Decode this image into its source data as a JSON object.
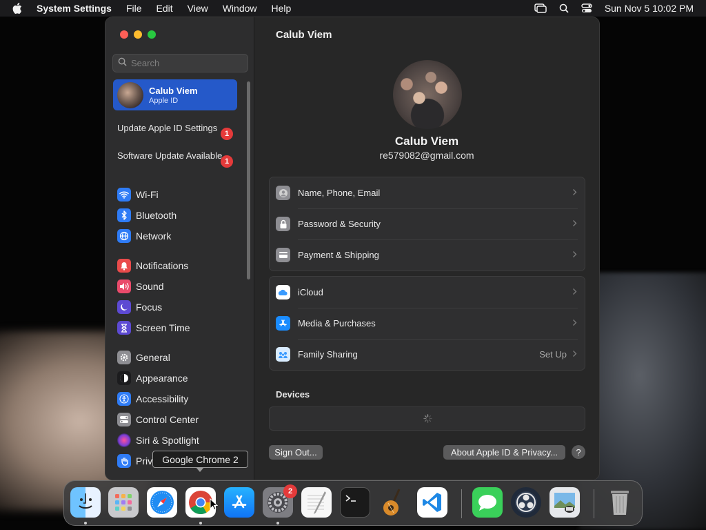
{
  "menubar": {
    "app_name": "System Settings",
    "items": [
      "File",
      "Edit",
      "View",
      "Window",
      "Help"
    ],
    "clock": "Sun Nov 5  10:02 PM"
  },
  "sidebar": {
    "search_placeholder": "Search",
    "account": {
      "name": "Calub Viem",
      "subtitle": "Apple ID"
    },
    "notices": [
      {
        "label": "Update Apple ID Settings",
        "badge": "1"
      },
      {
        "label": "Software Update Available",
        "badge": "1"
      }
    ],
    "items": [
      {
        "label": "Wi-Fi",
        "icon": "wifi-icon",
        "color": "#2f7cf6"
      },
      {
        "label": "Bluetooth",
        "icon": "bluetooth-icon",
        "color": "#2f7cf6"
      },
      {
        "label": "Network",
        "icon": "network-icon",
        "color": "#2f7cf6"
      },
      {
        "label": "Notifications",
        "icon": "bell-icon",
        "color": "#ea4b4b"
      },
      {
        "label": "Sound",
        "icon": "speaker-icon",
        "color": "#ea4b6b"
      },
      {
        "label": "Focus",
        "icon": "moon-icon",
        "color": "#5d4ad3"
      },
      {
        "label": "Screen Time",
        "icon": "hourglass-icon",
        "color": "#5d4ad3"
      },
      {
        "label": "General",
        "icon": "gear-icon",
        "color": "#8e8e93"
      },
      {
        "label": "Appearance",
        "icon": "appearance-icon",
        "color": "#1c1c1e"
      },
      {
        "label": "Accessibility",
        "icon": "accessibility-icon",
        "color": "#2f7cf6"
      },
      {
        "label": "Control Center",
        "icon": "control-center-icon",
        "color": "#8e8e93"
      },
      {
        "label": "Siri & Spotlight",
        "icon": "siri-icon",
        "color": "#7a3fd6"
      },
      {
        "label": "Priv",
        "icon": "hand-icon",
        "color": "#2f7cf6"
      }
    ]
  },
  "main": {
    "title": "Calub Viem",
    "profile": {
      "name": "Calub Viem",
      "email": "re579082@gmail.com"
    },
    "group1": [
      {
        "label": "Name, Phone, Email",
        "icon": "person-icon",
        "color": "#8e8e93"
      },
      {
        "label": "Password & Security",
        "icon": "lock-icon",
        "color": "#8e8e93"
      },
      {
        "label": "Payment & Shipping",
        "icon": "card-icon",
        "color": "#8e8e93"
      }
    ],
    "group2": [
      {
        "label": "iCloud",
        "icon": "icloud-icon",
        "color": "#ffffff",
        "value": ""
      },
      {
        "label": "Media & Purchases",
        "icon": "app-store-icon",
        "color": "#1a8cff",
        "value": ""
      },
      {
        "label": "Family Sharing",
        "icon": "family-icon",
        "color": "#d9ecff",
        "value": "Set Up"
      }
    ],
    "devices_title": "Devices",
    "sign_out": "Sign Out...",
    "about": "About Apple ID & Privacy...",
    "help": "?"
  },
  "tooltip": "Google Chrome 2",
  "dock": {
    "apps": [
      "Finder",
      "Launchpad",
      "Safari",
      "Google Chrome",
      "App Store",
      "System Settings",
      "TextEdit",
      "Terminal",
      "GarageBand",
      "Visual Studio Code",
      "Messages",
      "OBS",
      "Preview",
      "Trash"
    ],
    "settings_badge": "2"
  }
}
